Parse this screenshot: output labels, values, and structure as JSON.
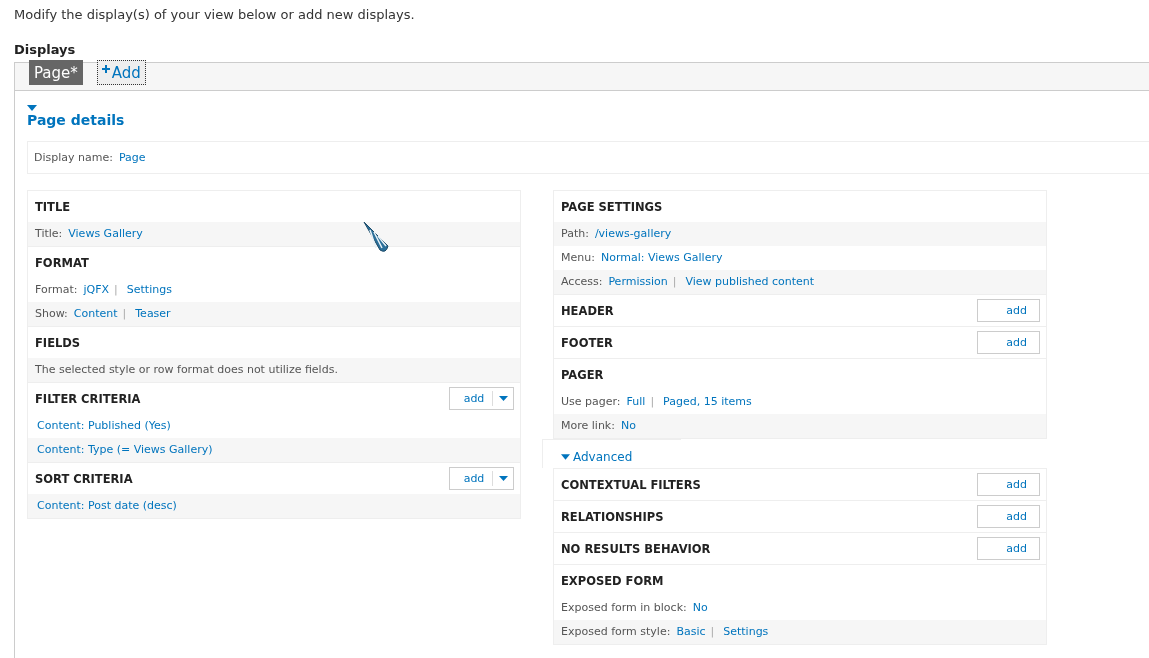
{
  "intro": "Modify the display(s) of your view below or add new displays.",
  "displays": {
    "heading": "Displays",
    "tabs": [
      {
        "label": "Page*",
        "selected": true
      }
    ],
    "add_button": "Add"
  },
  "details": {
    "label": "Page details",
    "expanded": true,
    "display_name": {
      "label": "Display name:",
      "value": "Page"
    }
  },
  "left_column": [
    {
      "title": "TITLE",
      "rows": [
        {
          "label": "Title:",
          "values": [
            "Views Gallery"
          ]
        }
      ]
    },
    {
      "title": "FORMAT",
      "rows": [
        {
          "label": "Format:",
          "values": [
            "jQFX",
            "Settings"
          ],
          "separator": "|"
        },
        {
          "label": "Show:",
          "values": [
            "Content",
            "Teaser"
          ],
          "separator": "|"
        }
      ]
    },
    {
      "title": "FIELDS",
      "rows": [
        {
          "kind": "text",
          "text": "The selected style or row format does not utilize fields."
        }
      ]
    },
    {
      "title": "FILTER CRITERIA",
      "add": {
        "label": "add",
        "kind": "dropdown"
      },
      "rows": [
        {
          "values": [
            "Content: Published (Yes)"
          ]
        },
        {
          "values": [
            "Content: Type (= Views Gallery)"
          ]
        }
      ]
    },
    {
      "title": "SORT CRITERIA",
      "add": {
        "label": "add",
        "kind": "dropdown"
      },
      "rows": [
        {
          "values": [
            "Content: Post date (desc)"
          ]
        }
      ]
    }
  ],
  "right_column": [
    {
      "title": "PAGE SETTINGS",
      "rows": [
        {
          "label": "Path:",
          "values": [
            "/views-gallery"
          ]
        },
        {
          "label": "Menu:",
          "values": [
            "Normal: Views Gallery"
          ]
        },
        {
          "label": "Access:",
          "values": [
            "Permission",
            "View published content"
          ],
          "separator": "|"
        }
      ]
    },
    {
      "title": "HEADER",
      "add": {
        "label": "add",
        "kind": "plain"
      }
    },
    {
      "title": "FOOTER",
      "add": {
        "label": "add",
        "kind": "plain"
      }
    },
    {
      "title": "PAGER",
      "rows": [
        {
          "label": "Use pager:",
          "values": [
            "Full",
            "Paged, 15 items"
          ],
          "separator": "|"
        },
        {
          "label": "More link:",
          "values": [
            "No"
          ]
        }
      ]
    }
  ],
  "advanced": {
    "label": "Advanced",
    "expanded": true,
    "sections": [
      {
        "title": "CONTEXTUAL FILTERS",
        "add": {
          "label": "add",
          "kind": "plain"
        }
      },
      {
        "title": "RELATIONSHIPS",
        "add": {
          "label": "add",
          "kind": "plain"
        }
      },
      {
        "title": "NO RESULTS BEHAVIOR",
        "add": {
          "label": "add",
          "kind": "plain"
        }
      },
      {
        "title": "EXPOSED FORM",
        "rows": [
          {
            "label": "Exposed form in block:",
            "values": [
              "No"
            ]
          },
          {
            "label": "Exposed form style:",
            "values": [
              "Basic",
              "Settings"
            ],
            "separator": "|"
          }
        ]
      }
    ]
  }
}
